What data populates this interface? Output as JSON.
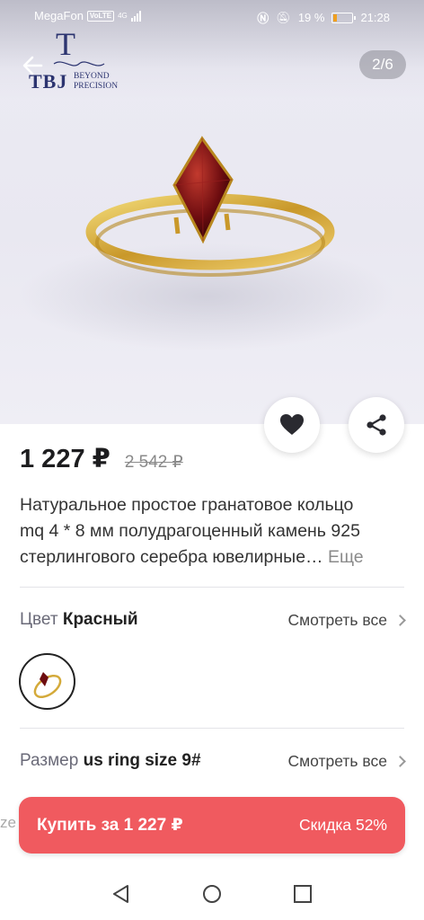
{
  "status_bar": {
    "carrier": "MegaFon",
    "volte": "VoLTE",
    "network": "4G",
    "battery": "19 %",
    "time": "21:28"
  },
  "header": {
    "logo_letter": "T",
    "logo_brand": "TBJ",
    "logo_tagline_1": "BEYOND",
    "logo_tagline_2": "PRECISION",
    "page_counter": "2/6",
    "icons": [
      "back-arrow-icon",
      "favorite-heart-icon",
      "share-icon"
    ]
  },
  "product": {
    "price": "1 227 ₽",
    "old_price": "2 542 ₽",
    "title_lines": [
      "Натуральное простое гранатовое кольцо",
      "mq 4 * 8 мм полудрагоценный камень 925",
      "стерлингового серебра ювелирные…"
    ],
    "more_label": "Еще"
  },
  "options": {
    "color": {
      "label": "Цвет",
      "value": "Красный",
      "see_all": "Смотреть все"
    },
    "size": {
      "label": "Размер",
      "value": "us ring size 9#",
      "see_all": "Смотреть все"
    }
  },
  "bottom": {
    "peek_text": "ze",
    "buy_label": "Купить за 1 227 ₽",
    "discount_label": "Скидка 52%"
  },
  "colors": {
    "buy_bar": "#f05a5f",
    "gem": "#7a0f12",
    "gold": "#d9b33a"
  }
}
